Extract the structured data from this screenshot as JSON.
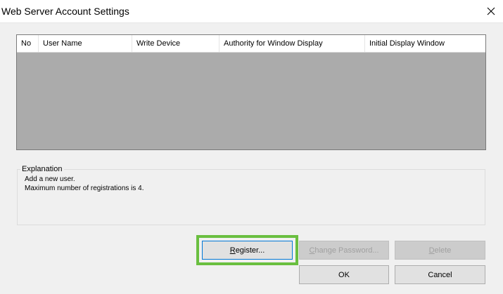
{
  "window": {
    "title": "Web Server Account Settings"
  },
  "table": {
    "columns": [
      "No",
      "User Name",
      "Write Device",
      "Authority for Window Display",
      "Initial Display Window"
    ],
    "rows": []
  },
  "explanation": {
    "legend": "Explanation",
    "lines": [
      "Add a new user.",
      "Maximum number of registrations is 4."
    ]
  },
  "buttons": {
    "register": "Register...",
    "change_password": "Change Password...",
    "delete": "Delete",
    "ok": "OK",
    "cancel": "Cancel"
  },
  "colors": {
    "highlight": "#6abf40",
    "table_body": "#ababab",
    "focus_border": "#0078d7"
  },
  "icons": {
    "close": "close-icon"
  }
}
